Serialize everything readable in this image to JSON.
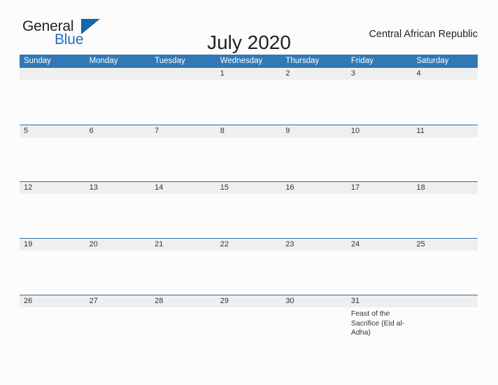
{
  "brand": {
    "name_part1": "General",
    "name_part2": "Blue",
    "logo_icon": "triangle-flag-icon",
    "accent_color": "#1267ad"
  },
  "header": {
    "title": "July 2020",
    "locale": "Central African Republic"
  },
  "theme": {
    "header_blue": "#3178b4",
    "row_divider": "#2e6da4",
    "date_band_gray": "#efefef",
    "page_background": "#fcfcfc",
    "text_color": "#231f20"
  },
  "calendar": {
    "weekdays": [
      "Sunday",
      "Monday",
      "Tuesday",
      "Wednesday",
      "Thursday",
      "Friday",
      "Saturday"
    ],
    "weeks": [
      [
        {
          "day": "",
          "event": ""
        },
        {
          "day": "",
          "event": ""
        },
        {
          "day": "",
          "event": ""
        },
        {
          "day": "1",
          "event": ""
        },
        {
          "day": "2",
          "event": ""
        },
        {
          "day": "3",
          "event": ""
        },
        {
          "day": "4",
          "event": ""
        }
      ],
      [
        {
          "day": "5",
          "event": ""
        },
        {
          "day": "6",
          "event": ""
        },
        {
          "day": "7",
          "event": ""
        },
        {
          "day": "8",
          "event": ""
        },
        {
          "day": "9",
          "event": ""
        },
        {
          "day": "10",
          "event": ""
        },
        {
          "day": "11",
          "event": ""
        }
      ],
      [
        {
          "day": "12",
          "event": ""
        },
        {
          "day": "13",
          "event": ""
        },
        {
          "day": "14",
          "event": ""
        },
        {
          "day": "15",
          "event": ""
        },
        {
          "day": "16",
          "event": ""
        },
        {
          "day": "17",
          "event": ""
        },
        {
          "day": "18",
          "event": ""
        }
      ],
      [
        {
          "day": "19",
          "event": ""
        },
        {
          "day": "20",
          "event": ""
        },
        {
          "day": "21",
          "event": ""
        },
        {
          "day": "22",
          "event": ""
        },
        {
          "day": "23",
          "event": ""
        },
        {
          "day": "24",
          "event": ""
        },
        {
          "day": "25",
          "event": ""
        }
      ],
      [
        {
          "day": "26",
          "event": ""
        },
        {
          "day": "27",
          "event": ""
        },
        {
          "day": "28",
          "event": ""
        },
        {
          "day": "29",
          "event": ""
        },
        {
          "day": "30",
          "event": ""
        },
        {
          "day": "31",
          "event": "Feast of the Sacrifice (Eid al-Adha)"
        },
        {
          "day": "",
          "event": ""
        }
      ]
    ]
  }
}
